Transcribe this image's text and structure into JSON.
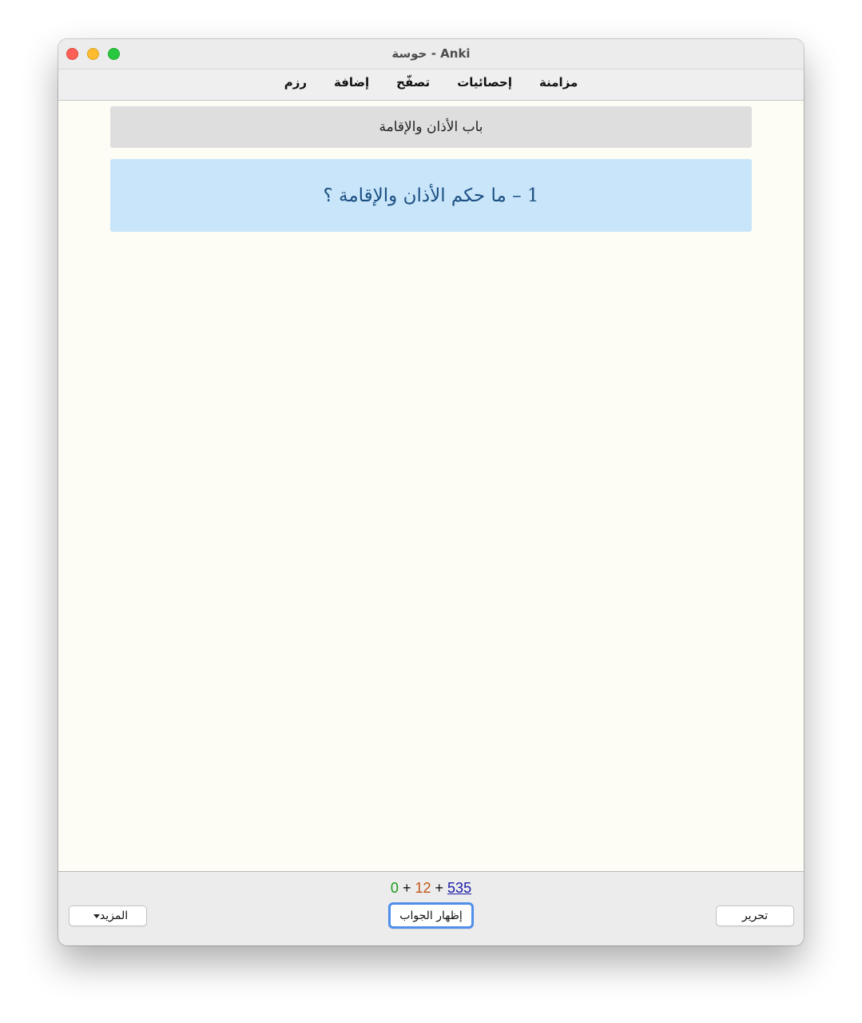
{
  "window": {
    "title": "حوسة - Anki"
  },
  "menubar": {
    "items": [
      {
        "label": "رزم"
      },
      {
        "label": "إضافة"
      },
      {
        "label": "تصفّح"
      },
      {
        "label": "إحصائيات"
      },
      {
        "label": "مزامنة"
      }
    ]
  },
  "card": {
    "deck_header": "باب الأذان والإقامة",
    "question": "1 – ما حكم الأذان والإقامة ؟"
  },
  "bottom": {
    "count_new": "0",
    "count_learn": "12",
    "count_review": "535",
    "plus": "+",
    "show_answer_label": "إظهار الجواب",
    "edit_label": "تحرير",
    "more_label": "المزيد"
  },
  "colors": {
    "new": "#1c9b1c",
    "learn": "#c35617",
    "review": "#1a1aa8",
    "question_bg": "#c8e5fa",
    "question_text": "#1c4f82"
  },
  "icons": {
    "more_dropdown": "caret-down-icon"
  }
}
